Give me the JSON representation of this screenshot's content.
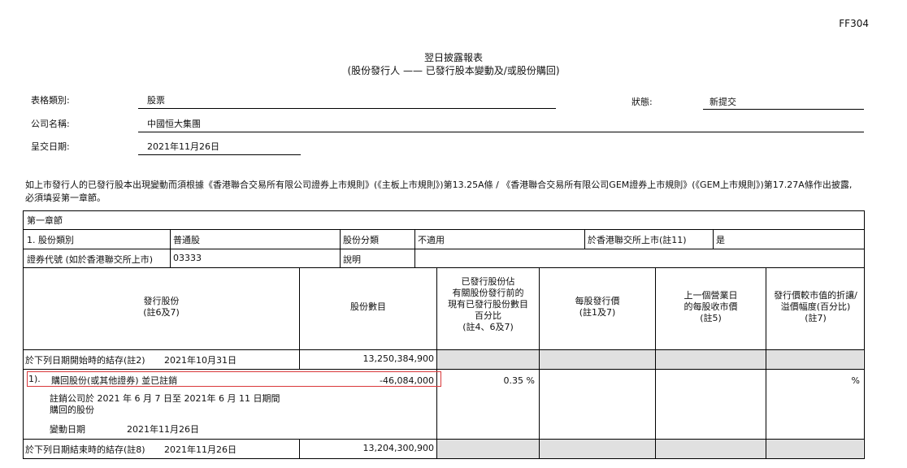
{
  "form_code": "FF304",
  "title": "翌日披露報表",
  "subtitle": "(股份發行人 —— 已發行股本變動及/或股份購回)",
  "header": {
    "form_type_label": "表格類別:",
    "form_type_value": "股票",
    "status_label": "狀態:",
    "status_value": "新提交",
    "company_label": "公司名稱:",
    "company_value": "中國恒大集團",
    "date_label": "呈交日期:",
    "date_value": "2021年11月26日"
  },
  "note_text": "如上市發行人的已發行股本出現變動而須根據《香港聯合交易所有限公司證券上市規則》(《主板上市規則》)第13.25A條 / 《香港聯合交易所有限公司GEM證券上市規則》(《GEM上市規則》)第17.27A條作出披露,必須填妥第一章節。",
  "section": {
    "title": "第一章節",
    "class_label": "1. 股份類別",
    "class_value": "普通股",
    "category_label": "股份分類",
    "category_value": "不適用",
    "listed_label": "於香港聯交所上市(註11)",
    "listed_value": "是",
    "code_label": "證券代號 (如於香港聯交所上市)",
    "code_value": "03333",
    "desc_label": "說明",
    "desc_value": ""
  },
  "columns": {
    "issued": "發行股份\n(註6及7)",
    "count": "股份數目",
    "percent": "已發行股份佔\n有關股份發行前的\n現有已發行股份數目\n百分比\n(註4、6及7)",
    "price": "每股發行價\n(註1及7)",
    "close": "上一個營業日\n的每股收市價\n(註5)",
    "discount": "發行價較市值的折讓/\n溢價幅度(百分比)\n(註7)"
  },
  "rows": {
    "opening_label": "於下列日期開始時的結存(註2)",
    "opening_date": "2021年10月31日",
    "opening_value": "13,250,384,900",
    "event_no": "1).",
    "event_label": "購回股份(或其他證券) 並已註銷",
    "event_value": "-46,084,000",
    "event_percent": "0.35 %",
    "event_discount": "%",
    "event_detail": "註銷公司於 2021 年 6 月 7 日至 2021年 6 月 11 日期間\n購回的股份",
    "change_date_label": "變動日期",
    "change_date_value": "2021年11月26日",
    "closing_label": "於下列日期結束時的結存(註8)",
    "closing_date": "2021年11月26日",
    "closing_value": "13,204,300,900"
  }
}
